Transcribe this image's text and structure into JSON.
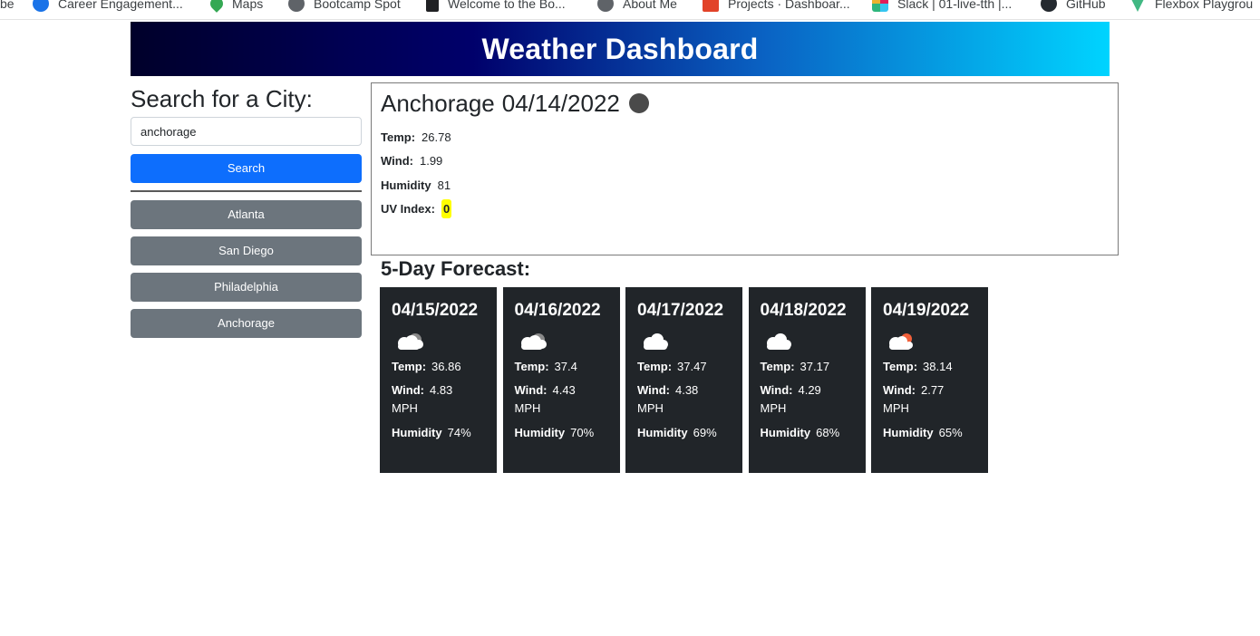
{
  "bookmarks": [
    {
      "label": "be",
      "icon": "none"
    },
    {
      "label": "Career Engagement...",
      "icon": "blue-circle-icon"
    },
    {
      "label": "Maps",
      "icon": "maps-pin-icon"
    },
    {
      "label": "Bootcamp Spot",
      "icon": "globe-icon"
    },
    {
      "label": "Welcome to the Bo...",
      "icon": "book-icon"
    },
    {
      "label": "About Me",
      "icon": "globe-icon"
    },
    {
      "label": "Projects · Dashboar...",
      "icon": "gitlab-fox-icon"
    },
    {
      "label": "Slack | 01-live-tth |...",
      "icon": "slack-icon"
    },
    {
      "label": "GitHub",
      "icon": "github-icon"
    },
    {
      "label": "Flexbox Playgrou",
      "icon": "vue-icon"
    }
  ],
  "header": {
    "title": "Weather Dashboard"
  },
  "search": {
    "title": "Search for a City:",
    "value": "anchorage",
    "button_label": "Search"
  },
  "history": [
    "Atlanta",
    "San Diego",
    "Philadelphia",
    "Anchorage"
  ],
  "current": {
    "city": "Anchorage",
    "date": "04/14/2022",
    "icon": "weather-icon",
    "temp_label": "Temp:",
    "temp": "26.78",
    "wind_label": "Wind:",
    "wind": "1.99",
    "humidity_label": "Humidity",
    "humidity": "81",
    "uv_label": "UV Index:",
    "uv": "0",
    "uv_color": "#ffff00"
  },
  "forecast": {
    "title": "5-Day Forecast:",
    "temp_label": "Temp:",
    "wind_label": "Wind:",
    "humidity_label": "Humidity",
    "wind_unit": "MPH",
    "days": [
      {
        "date": "04/15/2022",
        "icon": "dark-cloud-icon",
        "temp": "36.86",
        "wind": "4.83",
        "humidity": "74%"
      },
      {
        "date": "04/16/2022",
        "icon": "dark-cloud-icon",
        "temp": "37.4",
        "wind": "4.43",
        "humidity": "70%"
      },
      {
        "date": "04/17/2022",
        "icon": "cloud-icon",
        "temp": "37.47",
        "wind": "4.38",
        "humidity": "69%"
      },
      {
        "date": "04/18/2022",
        "icon": "cloud-icon",
        "temp": "37.17",
        "wind": "4.29",
        "humidity": "68%"
      },
      {
        "date": "04/19/2022",
        "icon": "sun-cloud-icon",
        "temp": "38.14",
        "wind": "2.77",
        "humidity": "65%"
      }
    ]
  },
  "colors": {
    "primary": "#0d6efd",
    "secondary": "#6c757d",
    "card": "#212529"
  }
}
